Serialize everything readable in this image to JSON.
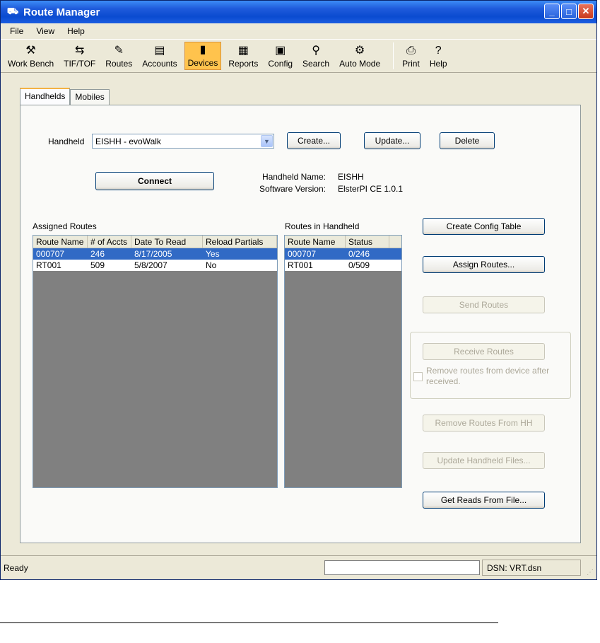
{
  "window": {
    "title": "Route Manager",
    "title_icon": "forklift-icon"
  },
  "menu": [
    "File",
    "View",
    "Help"
  ],
  "toolbar": {
    "items": [
      {
        "label": "Work Bench",
        "icon": "workbench-icon"
      },
      {
        "label": "TIF/TOF",
        "icon": "tif-tof-icon"
      },
      {
        "label": "Routes",
        "icon": "routes-icon"
      },
      {
        "label": "Accounts",
        "icon": "accounts-icon"
      },
      {
        "label": "Devices",
        "icon": "devices-icon"
      },
      {
        "label": "Reports",
        "icon": "reports-icon"
      },
      {
        "label": "Config",
        "icon": "config-icon"
      },
      {
        "label": "Search",
        "icon": "binoculars-icon"
      },
      {
        "label": "Auto Mode",
        "icon": "auto-mode-icon"
      },
      {
        "label": "Print",
        "icon": "print-icon"
      },
      {
        "label": "Help",
        "icon": "help-icon"
      }
    ],
    "active": "Devices"
  },
  "tabs": [
    "Handhelds",
    "Mobiles"
  ],
  "handheld": {
    "label": "Handheld",
    "selected": "EISHH - evoWalk",
    "create": "Create...",
    "update": "Update...",
    "delete": "Delete",
    "connect": "Connect",
    "name_label": "Handheld Name:",
    "name_value": "EISHH",
    "version_label": "Software Version:",
    "version_value": "ElsterPI CE 1.0.1"
  },
  "assigned": {
    "title": "Assigned Routes",
    "columns": [
      "Route Name",
      "# of Accts",
      "Date To Read",
      "Reload Partials"
    ],
    "rows": [
      [
        "000707",
        "246",
        "8/17/2005",
        "Yes"
      ],
      [
        "RT001",
        "509",
        "5/8/2007",
        "No"
      ]
    ]
  },
  "in_handheld": {
    "title": "Routes in Handheld",
    "columns": [
      "Route Name",
      "Status"
    ],
    "rows": [
      [
        "000707",
        "0/246"
      ],
      [
        "RT001",
        "0/509"
      ]
    ]
  },
  "actions": {
    "create_config": "Create Config Table",
    "assign": "Assign Routes...",
    "send": "Send Routes",
    "receive": "Receive Routes",
    "remove_after": "Remove routes from device after received.",
    "remove_hh": "Remove Routes From HH",
    "update_files": "Update Handheld Files...",
    "get_reads": "Get Reads From File..."
  },
  "status": {
    "text": "Ready",
    "dsn": "DSN: VRT.dsn"
  }
}
